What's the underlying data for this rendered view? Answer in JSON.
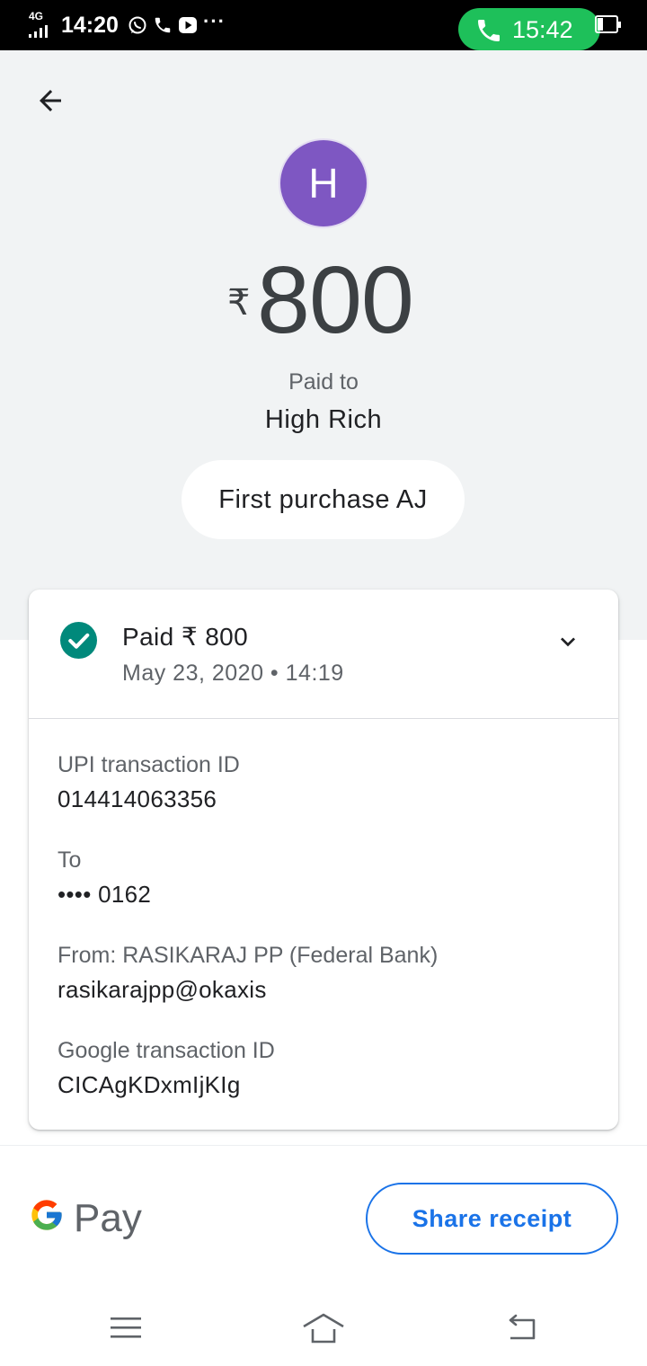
{
  "status_bar": {
    "network": "4G",
    "time": "14:20",
    "more": "···",
    "call_time": "15:42",
    "icons": [
      "whatsapp-icon",
      "phone-icon",
      "youtube-icon",
      "battery-icon"
    ]
  },
  "header": {
    "avatar_letter": "H",
    "currency_symbol": "₹",
    "amount": "800",
    "paid_to_label": "Paid to",
    "payee_name": "High Rich",
    "note": "First purchase AJ"
  },
  "card": {
    "status_title": "Paid ₹ 800",
    "datetime": "May 23, 2020 • 14:19",
    "details": [
      {
        "label": "UPI transaction ID",
        "value": "014414063356"
      },
      {
        "label": "To",
        "value": "•••• 0162"
      },
      {
        "label": "From: RASIKARAJ PP (Federal Bank)",
        "value": "rasikarajpp@okaxis"
      },
      {
        "label": "Google transaction ID",
        "value": "CICAgKDxmIjKIg"
      }
    ]
  },
  "footer": {
    "brand_text": "Pay",
    "share_label": "Share receipt"
  },
  "colors": {
    "header_bg": "#f1f3f4",
    "avatar": "#7e57c2",
    "success": "#00897b",
    "accent": "#1a73e8",
    "call_pill": "#1ec05a"
  }
}
